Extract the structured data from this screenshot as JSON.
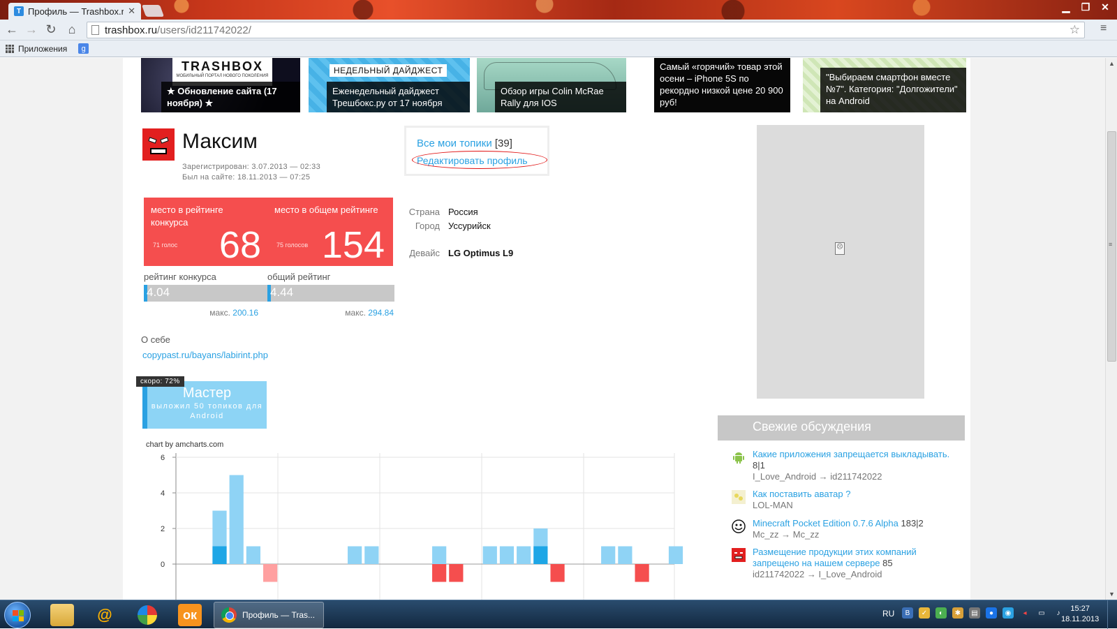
{
  "browser": {
    "tab_title": "Профиль — Trashbox.ru",
    "tab_favicon": "T",
    "url_host": "trashbox.ru",
    "url_path": "/users/id211742022/",
    "bookmarks_apps_label": "Приложения",
    "bookmark_google": "g"
  },
  "banners": [
    {
      "logo_big": "TRASHBOX",
      "logo_small": "МОБИЛЬНЫЙ ПОРТАЛ НОВОГО ПОКОЛЕНИЯ",
      "caption": "★ Обновление сайта (17 ноября) ★"
    },
    {
      "tag": "НЕДЕЛЬНЫЙ ДАЙДЖЕСТ",
      "caption": "Еженедельный дайджест Трешбокс.ру от 17 ноября"
    },
    {
      "caption": "Обзор игры Colin McRae Rally для IOS"
    },
    {
      "caption": "Самый «горячий» товар этой осени – iPhone 5S по рекордно низкой цене 20 900 руб!"
    },
    {
      "caption": "\"Выбираем смартфон вместе №7\". Категория: \"Долгожители\" на Android"
    }
  ],
  "profile": {
    "name": "Максим",
    "registered": "Зарегистрирован: 3.07.2013 — 02:33",
    "last_seen": "Был на сайте: 18.11.2013 — 07:25",
    "topics_link": "Все мои топики",
    "topics_count": "[39]",
    "edit_link": "Редактировать профиль"
  },
  "ranks": [
    {
      "label": "место в рейтинге конкурса",
      "votes": "71 голос",
      "number": "68",
      "bar_label": "рейтинг конкурса",
      "bar_value": "4.04",
      "bar_fill_fraction": 0.02,
      "max_label": "макс.",
      "max_value": "200.16"
    },
    {
      "label": "место в общем рейтинге",
      "votes": "75 голосов",
      "number": "154",
      "bar_label": "общий рейтинг",
      "bar_value": "4.44",
      "bar_fill_fraction": 0.015,
      "max_label": "макс.",
      "max_value": "294.84"
    }
  ],
  "info": {
    "country_label": "Страна",
    "country": "Россия",
    "city_label": "Город",
    "city": "Уссурийск",
    "device_label": "Девайс",
    "device": "LG Optimus L9"
  },
  "about": {
    "label": "О себе",
    "link": "copypast.ru/bayans/labirint.php"
  },
  "badge": {
    "soon": "скоро: 72%",
    "title": "Мастер",
    "subtitle": "выложил 50 топиков для Android"
  },
  "chart_credit": "chart by amcharts.com",
  "chart_data": {
    "type": "bar",
    "ylim": [
      -2,
      6
    ],
    "yticks": [
      "6",
      "4",
      "2",
      "0"
    ],
    "grid": true,
    "colors": {
      "light_pos": "#8fd3f5",
      "dark_pos": "#1ea6e6",
      "neg": "#f54e4e",
      "neg_light": "#ffa0a0"
    },
    "bars": [
      {
        "slot": 2,
        "value": 3,
        "inner": 1
      },
      {
        "slot": 3,
        "value": 5,
        "inner": 0
      },
      {
        "slot": 4,
        "value": 1,
        "inner": 0
      },
      {
        "slot": 5,
        "value": -1,
        "inner": 0,
        "light": true
      },
      {
        "slot": 10,
        "value": 1,
        "inner": 0
      },
      {
        "slot": 11,
        "value": 1,
        "inner": 0
      },
      {
        "slot": 15,
        "value": 1,
        "inner": 0
      },
      {
        "slot": 15,
        "value": -1,
        "inner": 0
      },
      {
        "slot": 16,
        "value": -1,
        "inner": 0
      },
      {
        "slot": 18,
        "value": 1,
        "inner": 0
      },
      {
        "slot": 19,
        "value": 1,
        "inner": 0
      },
      {
        "slot": 20,
        "value": 1,
        "inner": 0
      },
      {
        "slot": 21,
        "value": 2,
        "inner": 1
      },
      {
        "slot": 22,
        "value": -1,
        "inner": 0
      },
      {
        "slot": 25,
        "value": 1,
        "inner": 0
      },
      {
        "slot": 26,
        "value": 1,
        "inner": 0
      },
      {
        "slot": 27,
        "value": -1,
        "inner": 0
      },
      {
        "slot": 29,
        "value": 1,
        "inner": 0
      }
    ]
  },
  "sidebar": {
    "fresh_title": "Свежие обсуждения",
    "discussions": [
      {
        "icon": "android-icon",
        "title": "Какие приложения запрещается выкладывать.",
        "count": "8|1",
        "by": "I_Love_Android → id211742022"
      },
      {
        "icon": "avatar-lolman-icon",
        "title": "Как поставить аватар ?",
        "count": "",
        "by": "LOL-MAN"
      },
      {
        "icon": "avatar-troll-icon",
        "title": "Minecraft Pocket Edition 0.7.6 Alpha",
        "count": "183|2",
        "by": "Mc_zz → Mc_zz"
      },
      {
        "icon": "avatar-red-icon",
        "title": "Размещение продукции этих компаний запрещено на нашем сервере",
        "count": "85",
        "by": "id211742022 → I_Love_Android"
      }
    ]
  },
  "taskbar": {
    "active_window": "Профиль — Tras...",
    "lang": "RU",
    "time": "15:27",
    "date": "18.11.2013"
  }
}
